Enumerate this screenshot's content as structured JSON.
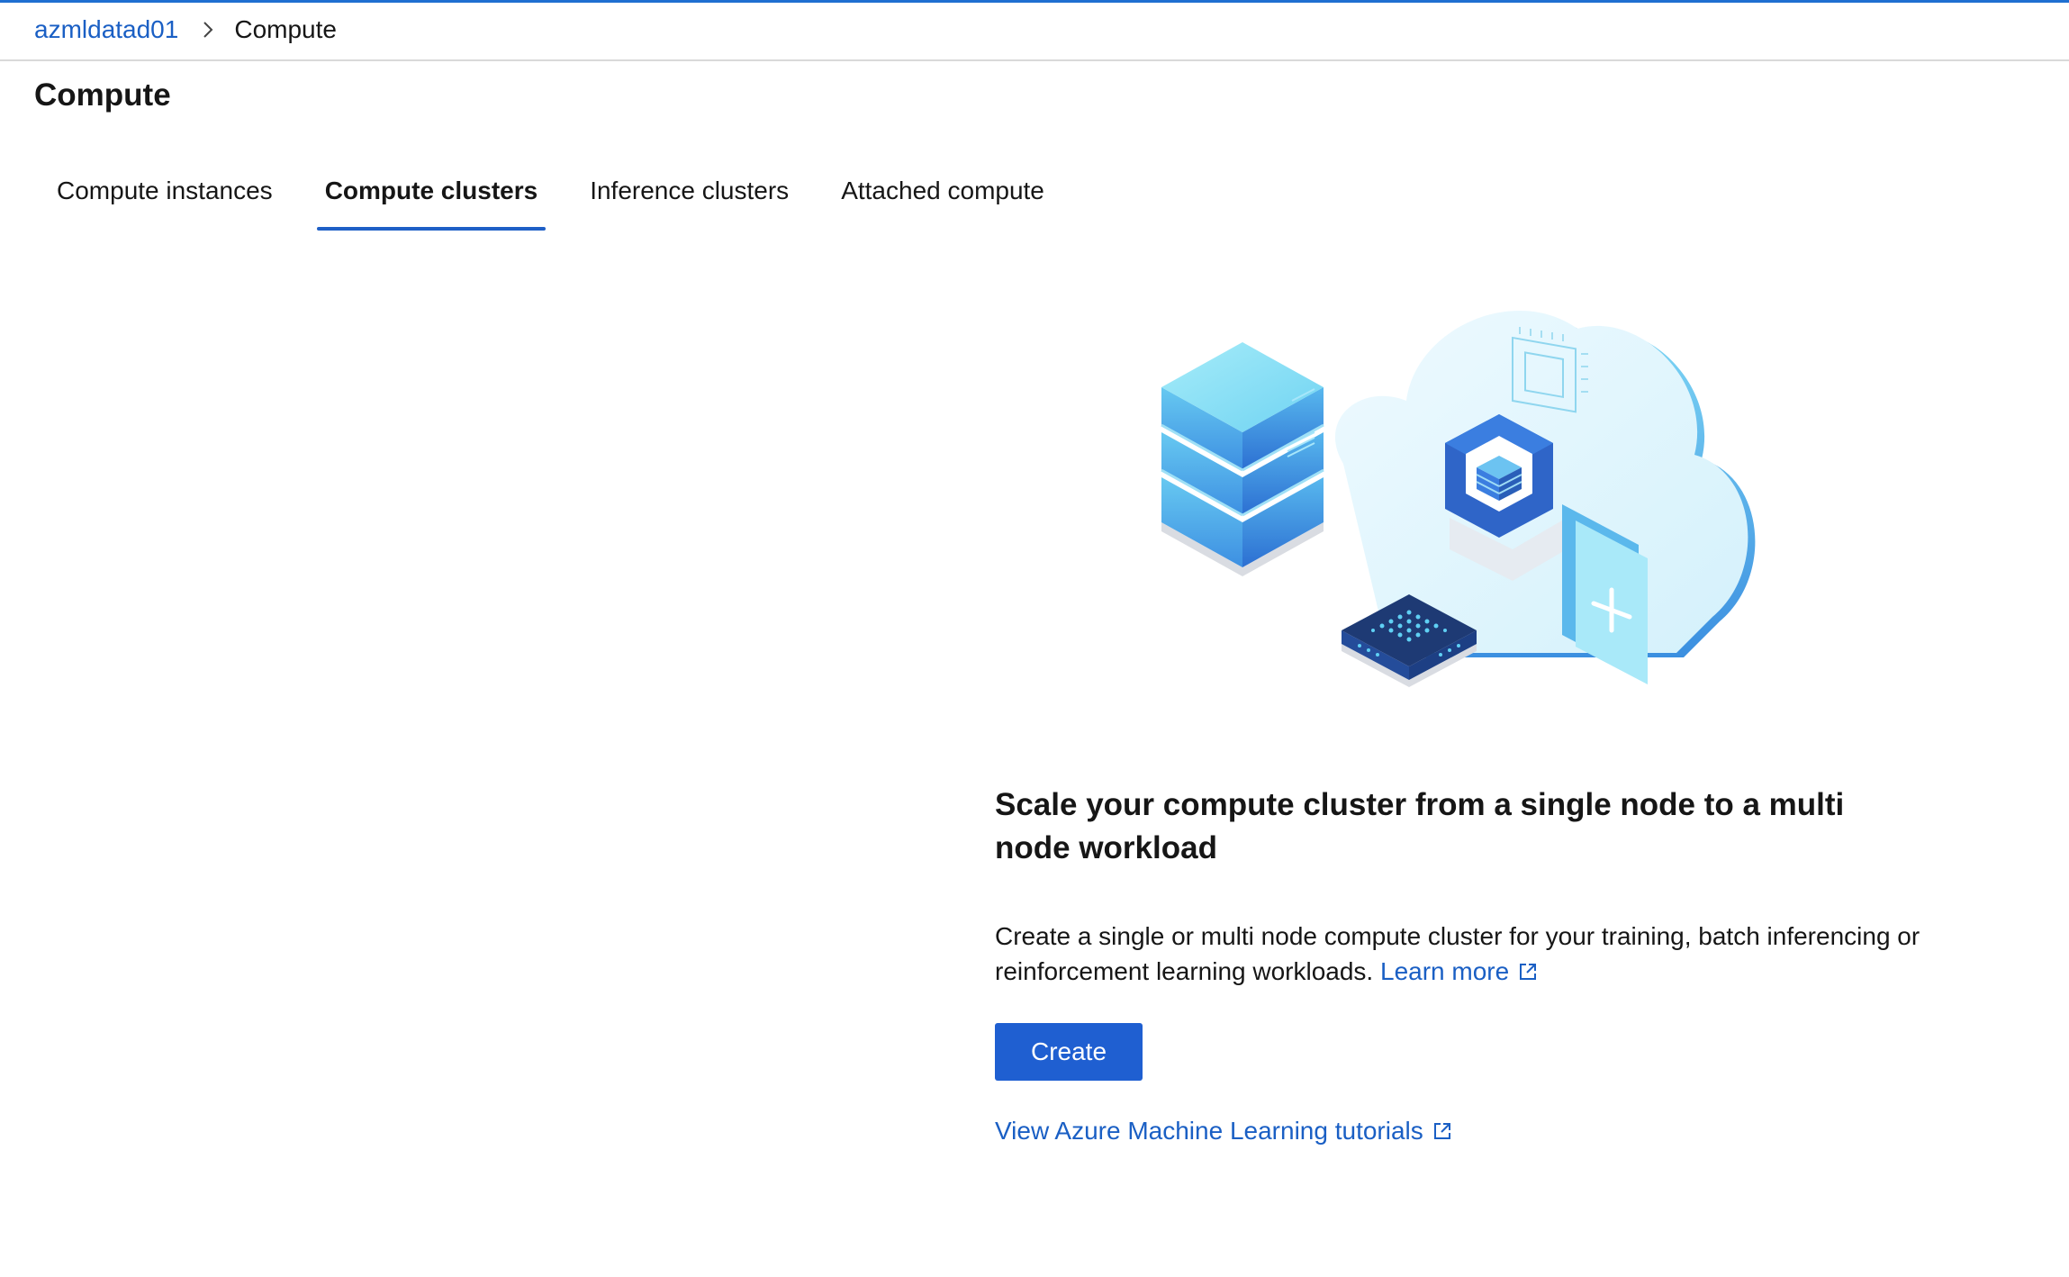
{
  "breadcrumb": {
    "workspace": "azmldatad01",
    "current": "Compute",
    "separator_icon": "chevron-right-icon"
  },
  "page": {
    "title": "Compute"
  },
  "tabs": [
    {
      "label": "Compute instances",
      "active": false
    },
    {
      "label": "Compute clusters",
      "active": true
    },
    {
      "label": "Inference clusters",
      "active": false
    },
    {
      "label": "Attached compute",
      "active": false
    }
  ],
  "empty_state": {
    "illustration_icon": "cloud-compute-cluster-illustration",
    "heading": "Scale your compute cluster from a single node to a multi node workload",
    "description": "Create a single or multi node compute cluster for your training, batch inferencing or reinforcement learning workloads.",
    "learn_more": "Learn more",
    "create_button": "Create",
    "tutorials_link": "View Azure Machine Learning tutorials",
    "external_link_icon": "external-link-icon"
  },
  "colors": {
    "accent": "#1f5fd1",
    "link": "#1a5fc4",
    "text": "#161616"
  }
}
